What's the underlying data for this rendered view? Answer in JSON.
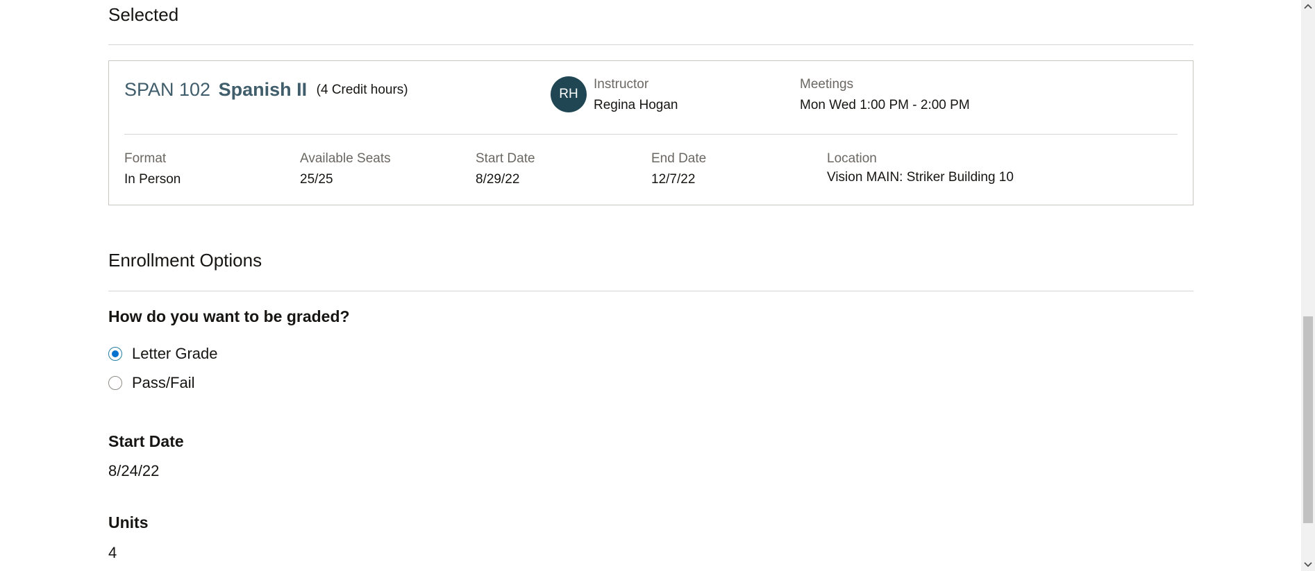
{
  "selected_section": {
    "title": "Selected"
  },
  "course": {
    "code": "SPAN 102",
    "name": "Spanish II",
    "credits": "(4 Credit hours)",
    "instructor": {
      "initials": "RH",
      "label": "Instructor",
      "name": "Regina Hogan"
    },
    "meetings": {
      "label": "Meetings",
      "value": "Mon Wed 1:00 PM - 2:00 PM"
    },
    "format": {
      "label": "Format",
      "value": "In Person"
    },
    "available_seats": {
      "label": "Available Seats",
      "value": "25/25"
    },
    "start_date": {
      "label": "Start Date",
      "value": "8/29/22"
    },
    "end_date": {
      "label": "End Date",
      "value": "12/7/22"
    },
    "location": {
      "label": "Location",
      "value": "Vision MAIN: Striker Building 10"
    }
  },
  "enrollment": {
    "title": "Enrollment Options",
    "grading_question": "How do you want to be graded?",
    "grading_options": [
      {
        "label": "Letter Grade",
        "selected": true
      },
      {
        "label": "Pass/Fail",
        "selected": false
      }
    ],
    "start_date": {
      "label": "Start Date",
      "value": "8/24/22"
    },
    "units": {
      "label": "Units",
      "value": "4"
    }
  },
  "colors": {
    "accent": "#0572ce",
    "course_title": "#3f5d6b",
    "avatar_bg": "#1f4652"
  },
  "icons": {
    "scroll_up": "chevron-up-icon",
    "scroll_down": "chevron-down-icon"
  }
}
